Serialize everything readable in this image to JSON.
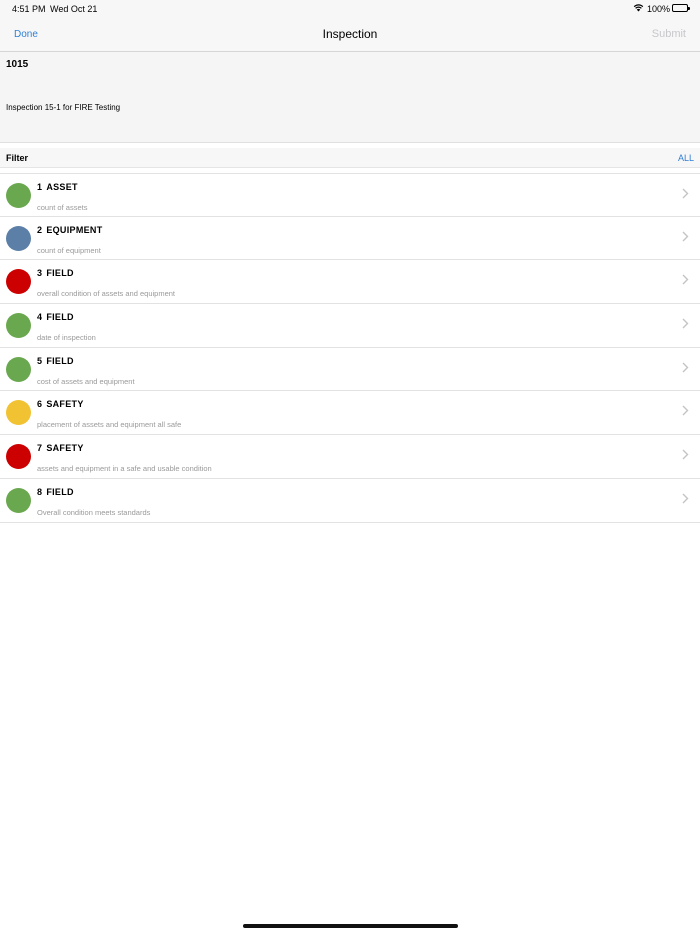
{
  "status_bar": {
    "time": "4:51 PM",
    "date": "Wed Oct 21",
    "battery": "100%",
    "wifi_icon": "wifi-icon"
  },
  "nav": {
    "done": "Done",
    "title": "Inspection",
    "submit": "Submit"
  },
  "inspection": {
    "number": "1015",
    "description": "Inspection 15-1 for FIRE Testing"
  },
  "filter": {
    "label": "Filter",
    "value": "ALL"
  },
  "colors": {
    "green": "#6aa84f",
    "blue": "#5b7fa6",
    "red": "#cc0000",
    "yellow": "#f1c232",
    "link": "#2f7fd6"
  },
  "items": [
    {
      "num": "1",
      "category": "ASSET",
      "subtitle": "count of assets",
      "color": "#6aa84f"
    },
    {
      "num": "2",
      "category": "EQUIPMENT",
      "subtitle": "count of equipment",
      "color": "#5b7fa6"
    },
    {
      "num": "3",
      "category": "FIELD",
      "subtitle": "overall condition of assets and equipment",
      "color": "#cc0000"
    },
    {
      "num": "4",
      "category": "FIELD",
      "subtitle": "date of inspection",
      "color": "#6aa84f"
    },
    {
      "num": "5",
      "category": "FIELD",
      "subtitle": "cost of assets and equipment",
      "color": "#6aa84f"
    },
    {
      "num": "6",
      "category": "SAFETY",
      "subtitle": "placement of assets and equipment all safe",
      "color": "#f1c232"
    },
    {
      "num": "7",
      "category": "SAFETY",
      "subtitle": "assets and equipment in a safe and usable condition",
      "color": "#cc0000"
    },
    {
      "num": "8",
      "category": "FIELD",
      "subtitle": "Overall condition meets standards",
      "color": "#6aa84f"
    }
  ]
}
